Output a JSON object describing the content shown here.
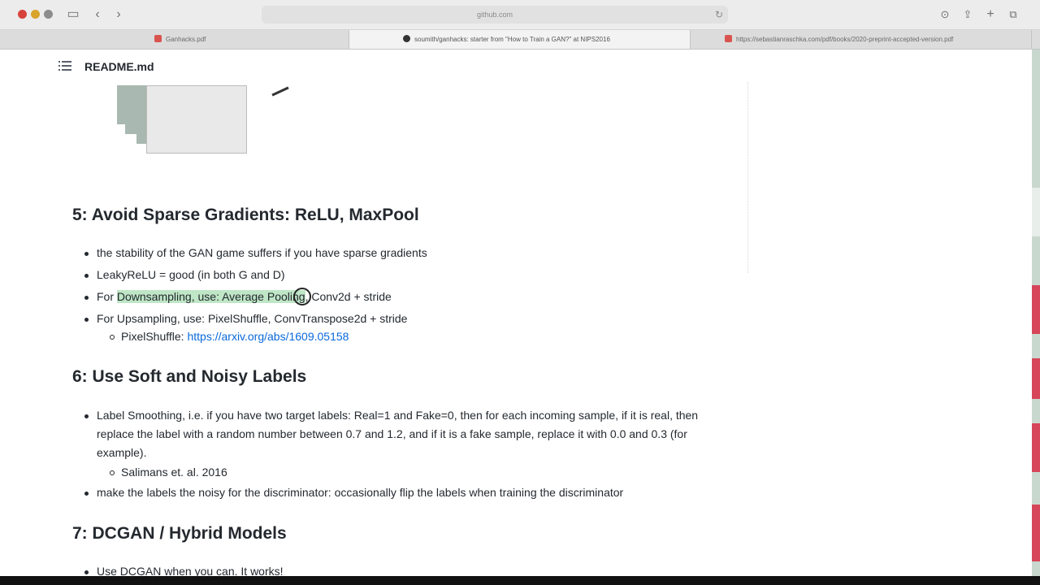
{
  "browser": {
    "url": "github.com",
    "tabs": [
      {
        "label": "Ganhacks.pdf",
        "active": false
      },
      {
        "label": "soumith/ganhacks: starter from \"How to Train a GAN?\" at NIPS2016",
        "active": true
      },
      {
        "label": "https://sebastianraschka.com/pdf/books/2020-preprint-accepted-version.pdf",
        "active": false
      }
    ]
  },
  "readme": {
    "title": "README.md"
  },
  "sections": {
    "s5": {
      "heading": "5: Avoid Sparse Gradients: ReLU, MaxPool",
      "items": [
        "the stability of the GAN game suffers if you have sparse gradients",
        "LeakyReLU = good (in both G and D)",
        {
          "prefix": "For ",
          "highlight": "Downsampling, use: Average Pooling",
          "suffix": ", Conv2d + stride"
        },
        "For Upsampling, use: PixelShuffle, ConvTranspose2d + stride"
      ],
      "sub_label": "PixelShuffle: ",
      "sub_link": "https://arxiv.org/abs/1609.05158"
    },
    "s6": {
      "heading": "6: Use Soft and Noisy Labels",
      "items": [
        "Label Smoothing, i.e. if you have two target labels: Real=1 and Fake=0, then for each incoming sample, if it is real, then replace the label with a random number between 0.7 and 1.2, and if it is a fake sample, replace it with 0.0 and 0.3 (for example).",
        "make the labels the noisy for the discriminator: occasionally flip the labels when training the discriminator"
      ],
      "sub_item": "Salimans et. al. 2016"
    },
    "s7": {
      "heading": "7: DCGAN / Hybrid Models",
      "items": [
        "Use DCGAN when you can. It works!"
      ]
    }
  },
  "colors": {
    "highlight": "#bfe6c6",
    "link": "#0969da",
    "heading": "#24292f"
  }
}
